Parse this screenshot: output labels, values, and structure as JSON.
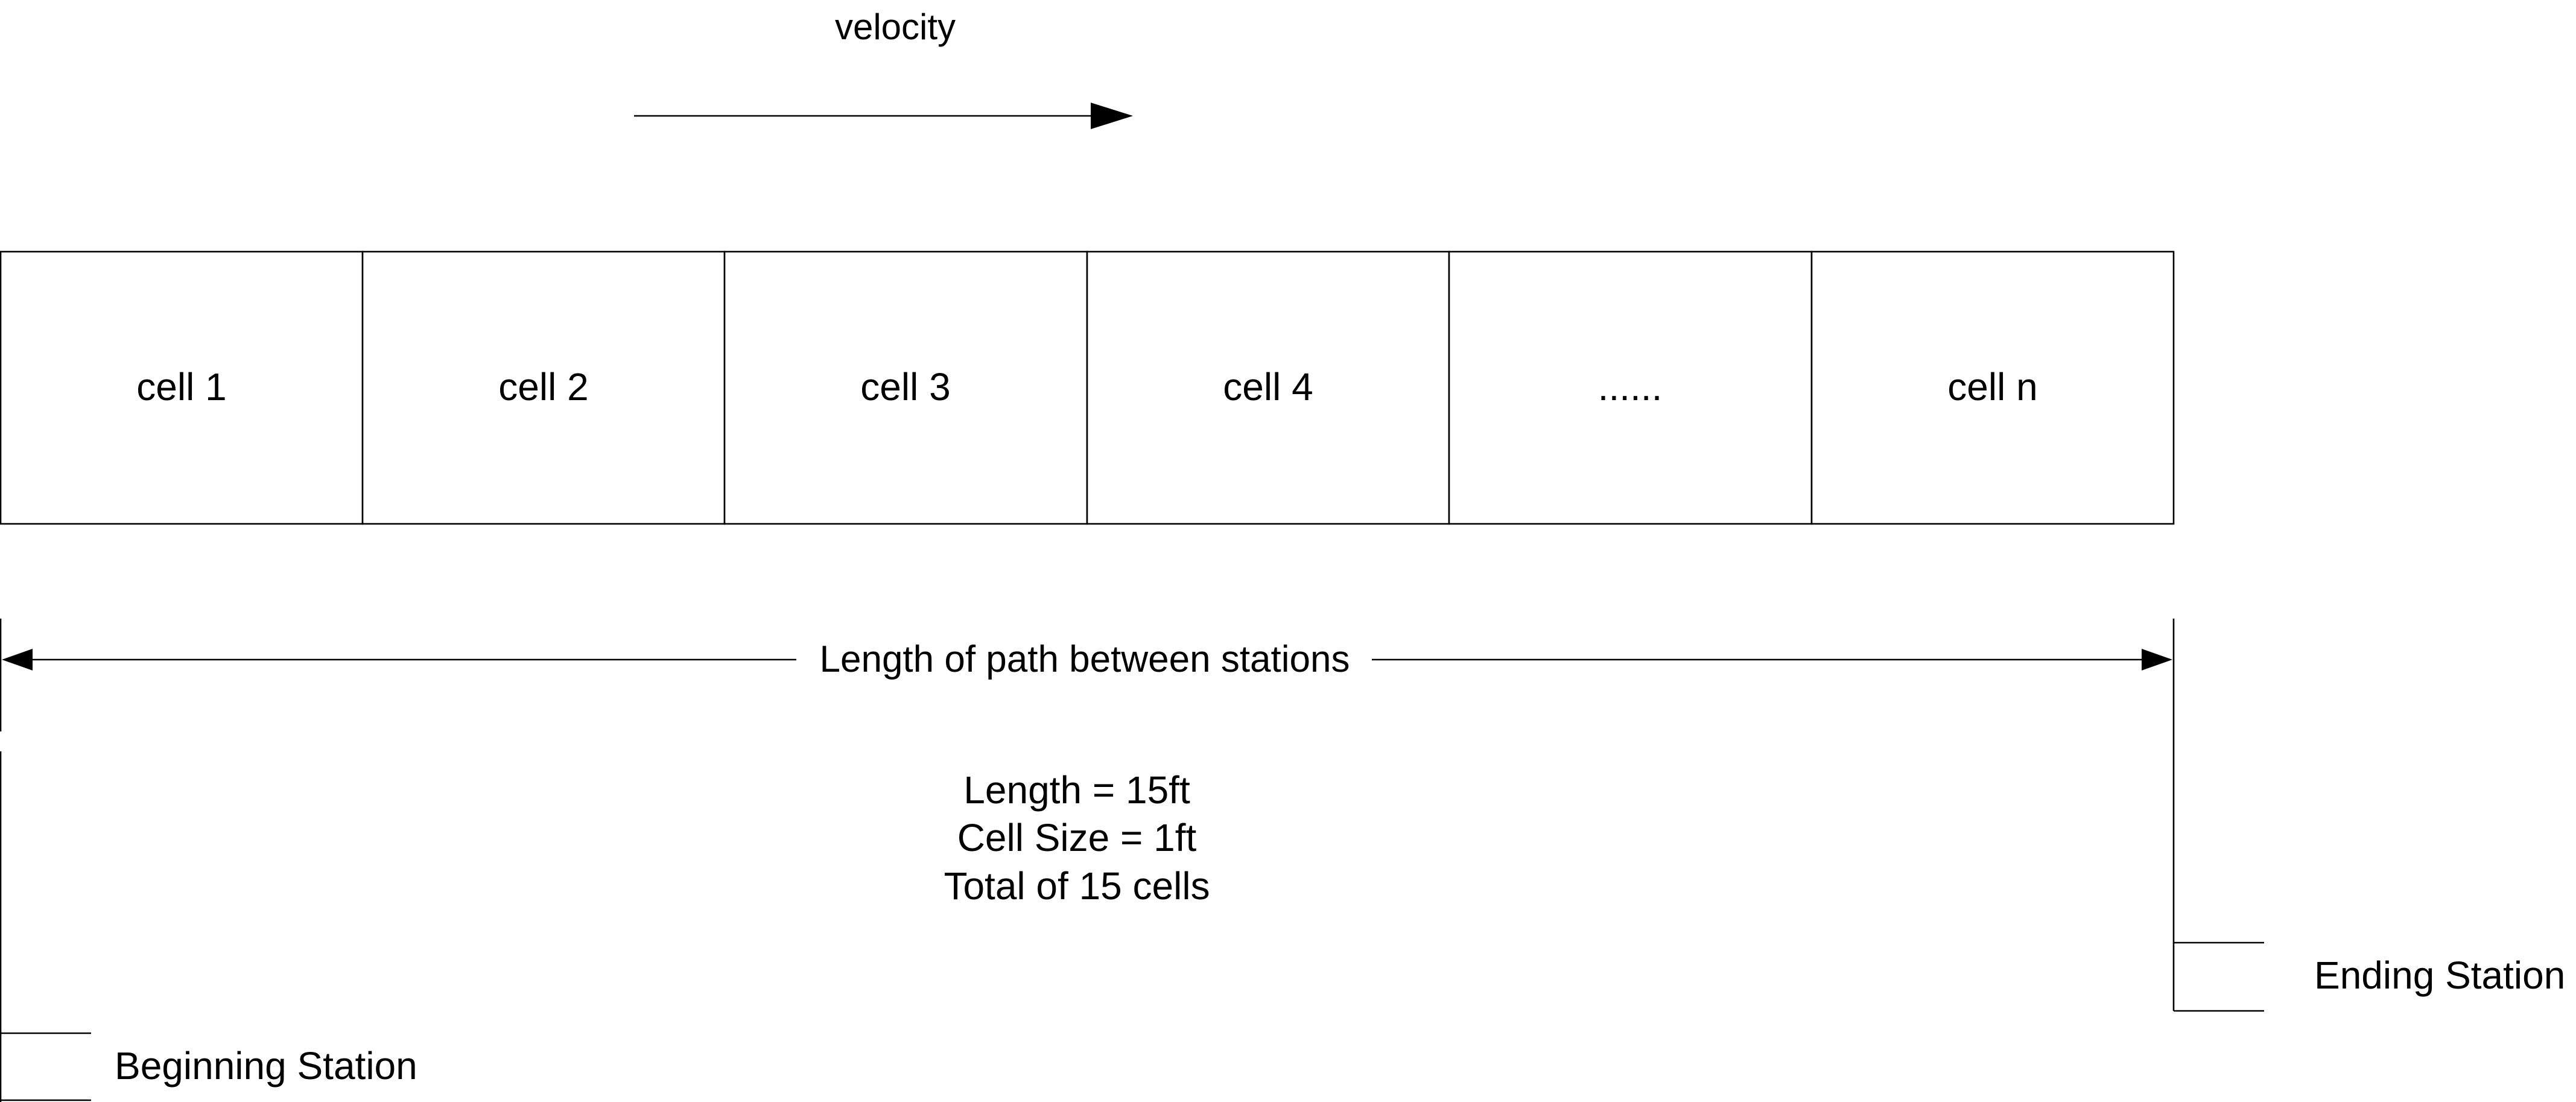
{
  "velocity": {
    "label": "velocity"
  },
  "cells": [
    {
      "label": "cell 1"
    },
    {
      "label": "cell 2"
    },
    {
      "label": "cell 3"
    },
    {
      "label": "cell 4"
    },
    {
      "label": "......"
    },
    {
      "label": "cell n"
    }
  ],
  "path_length": {
    "label": "Length of path between stations"
  },
  "info": {
    "lines": [
      "Length = 15ft",
      "Cell Size = 1ft",
      "Total of 15 cells"
    ]
  },
  "stations": {
    "beginning": "Beginning Station",
    "ending": "Ending Station"
  },
  "colors": {
    "stroke": "#000000",
    "background": "#ffffff"
  }
}
